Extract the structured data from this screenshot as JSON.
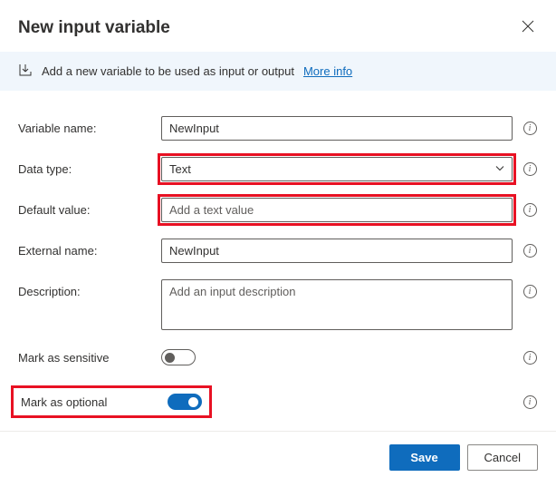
{
  "header": {
    "title": "New input variable"
  },
  "banner": {
    "text": "Add a new variable to be used as input or output",
    "link_label": "More info"
  },
  "fields": {
    "variable_name": {
      "label": "Variable name:",
      "value": "NewInput"
    },
    "data_type": {
      "label": "Data type:",
      "value": "Text"
    },
    "default_value": {
      "label": "Default value:",
      "value": "",
      "placeholder": "Add a text value"
    },
    "external_name": {
      "label": "External name:",
      "value": "NewInput"
    },
    "description": {
      "label": "Description:",
      "value": "",
      "placeholder": "Add an input description"
    },
    "sensitive": {
      "label": "Mark as sensitive",
      "value": false
    },
    "optional": {
      "label": "Mark as optional",
      "value": true
    }
  },
  "footer": {
    "save_label": "Save",
    "cancel_label": "Cancel"
  }
}
